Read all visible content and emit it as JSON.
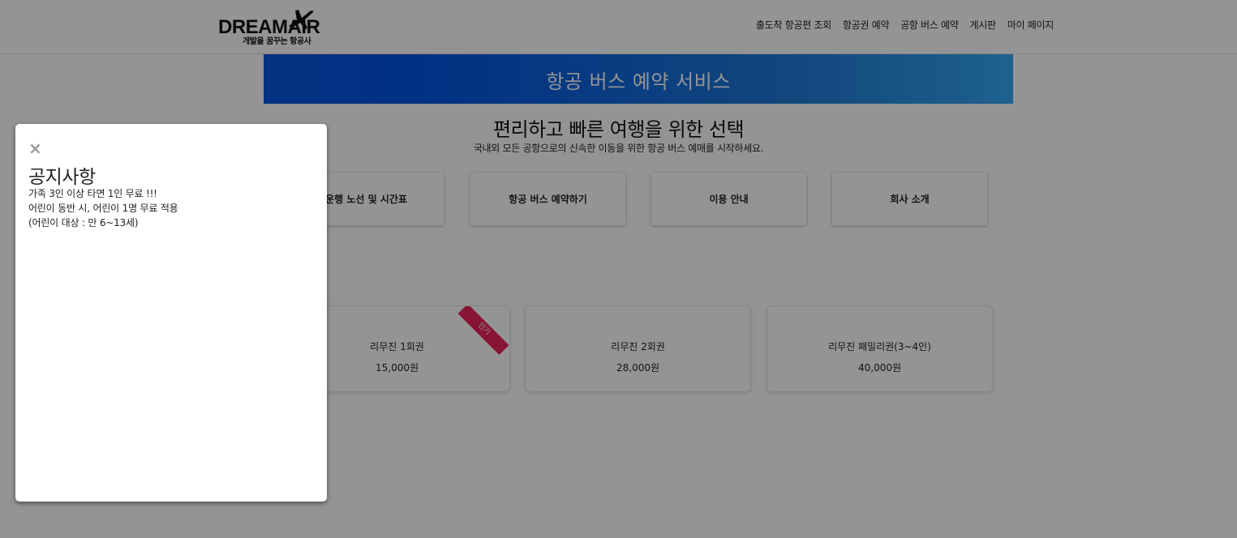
{
  "header": {
    "logo_text": "DREAMAIR",
    "logo_tagline": "개발을 꿈꾸는 항공사",
    "nav": [
      {
        "label": "출도착 항공편 조회"
      },
      {
        "label": "항공권 예약"
      },
      {
        "label": "공항 버스 예약"
      },
      {
        "label": "게시판"
      },
      {
        "label": "마이 페이지"
      }
    ]
  },
  "hero": {
    "title": "항공 버스 예약 서비스"
  },
  "section": {
    "title": "편리하고 빠른 여행을 위한 선택",
    "subtitle": "국내외 모든 공항으로의 신속한 이동을 위한 항공 버스 예매를 시작하세요."
  },
  "menu_cards": [
    {
      "label": "운행 노선 및 시간표"
    },
    {
      "label": "항공 버스 예약하기"
    },
    {
      "label": "이용 안내"
    },
    {
      "label": "회사 소개"
    }
  ],
  "tickets": [
    {
      "name": "리무진 1회권",
      "price": "15,000원",
      "ribbon": "인기"
    },
    {
      "name": "리무진 2회권",
      "price": "28,000원"
    },
    {
      "name": "리무진 패밀리권(3~4인)",
      "price": "40,000원"
    }
  ],
  "modal": {
    "close_symbol": "×",
    "title": "공지사항",
    "lines": [
      "가족 3인 이상 타면 1인 무료 !!!",
      "어린이 동반 시, 어린이 1명 무료 적용",
      "(어린이 대상 : 만 6~13세)"
    ]
  },
  "colors": {
    "hero_start": "#0054e3",
    "hero_end": "#35a8f5",
    "ribbon": "#e8245c",
    "overlay": "rgba(0,0,0,0.42)"
  },
  "icons": {
    "logo_mark": "airplane-icon",
    "close": "close-icon"
  }
}
